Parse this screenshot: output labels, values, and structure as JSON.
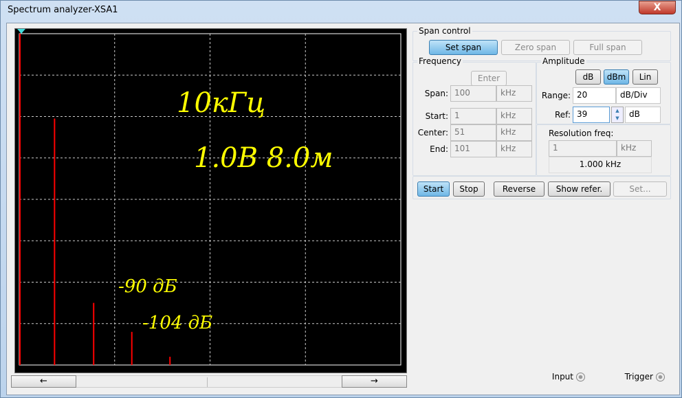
{
  "window": {
    "title": "Spectrum analyzer-XSA1",
    "close_label": "X"
  },
  "display": {
    "annotations": [
      "10кГц",
      "1.0В 8.0м",
      "-90 дБ",
      "-104 дБ"
    ],
    "trace_color": "#ff0000",
    "peaks": [
      {
        "freq_div": 0.37,
        "level_div": 2.05
      },
      {
        "freq_div": 0.78,
        "level_div": 6.5
      },
      {
        "freq_div": 1.18,
        "level_div": 7.2
      },
      {
        "freq_div": 1.58,
        "level_div": 7.8
      }
    ],
    "scroll_left": "←",
    "scroll_right": "→"
  },
  "span_control": {
    "title": "Span control",
    "set_span": "Set span",
    "zero_span": "Zero span",
    "full_span": "Full span"
  },
  "frequency": {
    "title": "Frequency",
    "enter": "Enter",
    "rows": [
      {
        "label": "Span:",
        "value": "100",
        "unit": "kHz"
      },
      {
        "label": "Start:",
        "value": "1",
        "unit": "kHz"
      },
      {
        "label": "Center:",
        "value": "51",
        "unit": "kHz"
      },
      {
        "label": "End:",
        "value": "101",
        "unit": "kHz"
      }
    ]
  },
  "amplitude": {
    "title": "Amplitude",
    "db": "dB",
    "dbm": "dBm",
    "lin": "Lin",
    "range_label": "Range:",
    "range_value": "20",
    "range_unit": "dB/Div",
    "ref_label": "Ref:",
    "ref_value": "39",
    "ref_unit": "dB"
  },
  "resolution": {
    "title": "Resolution freq:",
    "value": "1",
    "unit": "kHz",
    "readout": "1.000 kHz"
  },
  "controls": {
    "start": "Start",
    "stop": "Stop",
    "reverse": "Reverse",
    "show_refer": "Show refer.",
    "set": "Set..."
  },
  "io": {
    "input": "Input",
    "trigger": "Trigger"
  }
}
